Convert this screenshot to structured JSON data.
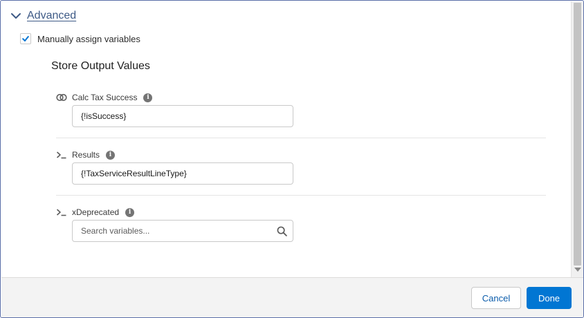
{
  "advanced": {
    "label": "Advanced",
    "expanded": true
  },
  "manual_assign": {
    "label": "Manually assign variables",
    "checked": true
  },
  "section_title": "Store Output Values",
  "fields": [
    {
      "label": "Calc Tax Success",
      "icon": "toggle-icon",
      "value": "{!isSuccess}"
    },
    {
      "label": "Results",
      "icon": "prompt-icon",
      "value": "{!TaxServiceResultLineType}"
    },
    {
      "label": "xDeprecated",
      "icon": "prompt-icon",
      "value": "",
      "placeholder": "Search variables..."
    }
  ],
  "footer": {
    "cancel_label": "Cancel",
    "done_label": "Done"
  },
  "colors": {
    "link": "#3e5a86",
    "brand": "#0176d3",
    "checkbox_check": "#0176d3"
  }
}
